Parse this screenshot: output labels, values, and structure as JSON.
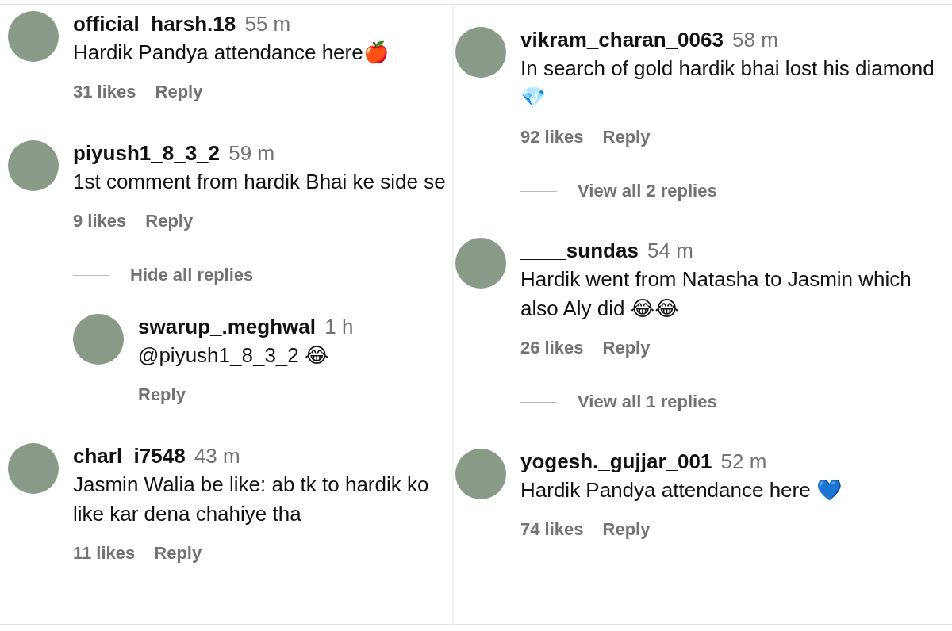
{
  "panels": [
    {
      "comments": [
        {
          "username": "official_harsh.18",
          "time": "55 m",
          "text": "Hardik Pandya attendance here🍎",
          "likes": "31 likes",
          "reply": "Reply"
        },
        {
          "username": "piyush1_8_3_2",
          "time": "59 m",
          "text": "1st comment from hardik Bhai ke side se",
          "likes": "9 likes",
          "reply": "Reply",
          "thread_toggle": "Hide all replies",
          "replies": [
            {
              "username": "swarup_.meghwal",
              "time": "1 h",
              "text": "@piyush1_8_3_2 😂",
              "reply": "Reply"
            }
          ]
        },
        {
          "username": "charl_i7548",
          "time": "43 m",
          "text": "Jasmin Walia be like: ab tk to hardik ko like kar dena chahiye tha",
          "likes": "11 likes",
          "reply": "Reply"
        }
      ]
    },
    {
      "comments": [
        {
          "username": "vikram_charan_0063",
          "time": "58 m",
          "text": "In search of gold hardik bhai lost his diamond 💎",
          "likes": "92 likes",
          "reply": "Reply",
          "thread_toggle": "View all 2 replies"
        },
        {
          "username": "____sundas",
          "time": "54 m",
          "text": "Hardik went from Natasha to Jasmin which also Aly did 😂😂",
          "likes": "26 likes",
          "reply": "Reply",
          "thread_toggle": "View all 1 replies"
        },
        {
          "username": "yogesh._gujjar_001",
          "time": "52 m",
          "text": "Hardik Pandya attendance here 💙",
          "likes": "74 likes",
          "reply": "Reply"
        }
      ]
    }
  ]
}
